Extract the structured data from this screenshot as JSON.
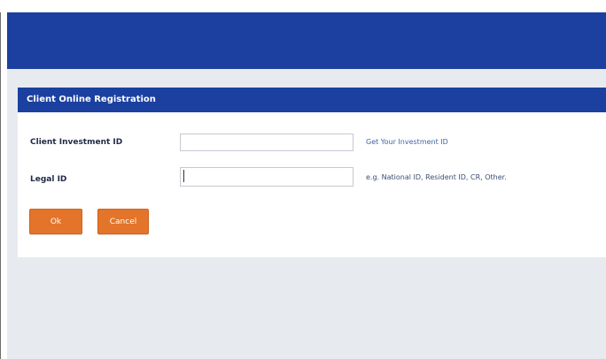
{
  "form": {
    "title": "Client Online Registration",
    "client_investment_id": {
      "label": "Client Investment ID",
      "value": "",
      "helper_link": "Get Your Investment ID"
    },
    "legal_id": {
      "label": "Legal ID",
      "value": "",
      "hint": "e.g. National ID, Resident ID, CR, Other."
    },
    "buttons": {
      "ok": "Ok",
      "cancel": "Cancel"
    }
  },
  "colors": {
    "brand_blue": "#1b40a0",
    "button_orange": "#e37429",
    "content_background": "#e7ebf0",
    "link_blue": "#3f67a6"
  }
}
